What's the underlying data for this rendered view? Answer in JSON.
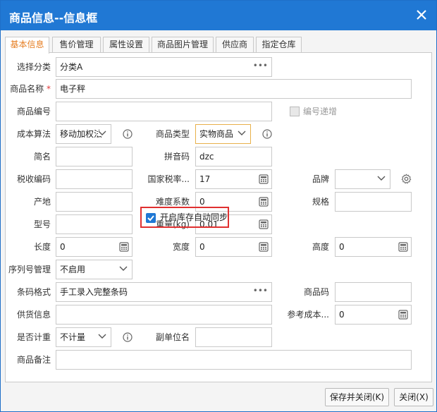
{
  "dialog": {
    "title": "商品信息--信息框"
  },
  "tabs": [
    "基本信息",
    "售价管理",
    "属性设置",
    "商品图片管理",
    "供应商",
    "指定仓库"
  ],
  "fields": {
    "category": {
      "label": "选择分类",
      "value": "分类A"
    },
    "name": {
      "label": "商品名称",
      "required_mark": "*",
      "value": "电子秤"
    },
    "code": {
      "label": "商品编号",
      "value": ""
    },
    "auto_increment": {
      "label": "编号递增",
      "checked": false
    },
    "cost_method": {
      "label": "成本算法",
      "value": "移动加权法"
    },
    "product_type": {
      "label": "商品类型",
      "value": "实物商品"
    },
    "short_name": {
      "label": "简名",
      "value": ""
    },
    "pinyin": {
      "label": "拼音码",
      "value": "dzc"
    },
    "tax_code": {
      "label": "税收编码",
      "value": ""
    },
    "tax_rate": {
      "label": "国家税率...",
      "value": "17"
    },
    "brand": {
      "label": "品牌",
      "value": ""
    },
    "origin": {
      "label": "产地",
      "value": ""
    },
    "difficulty": {
      "label": "难度系数",
      "value": "0"
    },
    "spec": {
      "label": "规格",
      "value": ""
    },
    "model": {
      "label": "型号",
      "value": ""
    },
    "weight": {
      "label": "重量(kg)",
      "value": "0.01"
    },
    "length": {
      "label": "长度",
      "value": "0"
    },
    "width": {
      "label": "宽度",
      "value": "0"
    },
    "height": {
      "label": "高度",
      "value": "0"
    },
    "serial_mgmt": {
      "label": "序列号管理",
      "value": "不启用"
    },
    "inventory_sync": {
      "label": "开启库存自动同步",
      "checked": true
    },
    "barcode_format": {
      "label": "条码格式",
      "value": "手工录入完整条码"
    },
    "product_code": {
      "label": "商品码",
      "value": ""
    },
    "supply_info": {
      "label": "供货信息",
      "value": ""
    },
    "ref_cost": {
      "label": "参考成本...",
      "value": "0"
    },
    "metered": {
      "label": "是否计重",
      "value": "不计量"
    },
    "sub_unit": {
      "label": "副单位名",
      "value": ""
    },
    "remark": {
      "label": "商品备注",
      "value": ""
    }
  },
  "footer": {
    "save_close": "保存并关闭(K)",
    "close": "关闭(X)"
  },
  "colors": {
    "titlebar": "#2078d4",
    "active_tab_text": "#e67e22",
    "highlight": "#e03030"
  }
}
